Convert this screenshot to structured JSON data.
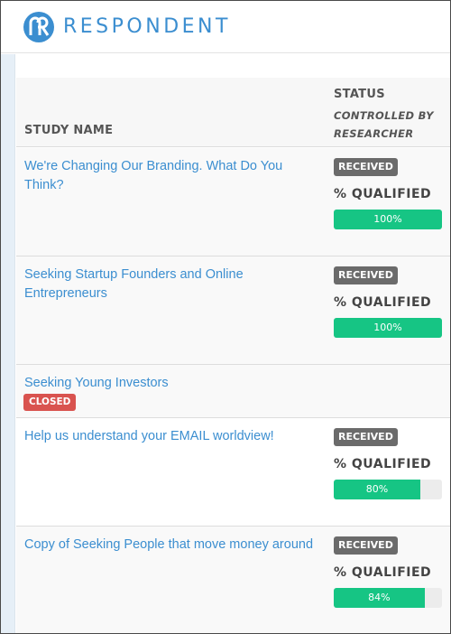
{
  "brand": {
    "name": "RESPONDENT",
    "accent": "#3b8ed0"
  },
  "table": {
    "col_name": "STUDY NAME",
    "col_status": "STATUS",
    "col_status_sub": "CONTROLLED BY RESEARCHER"
  },
  "qualified_label": "% QUALIFIED",
  "colors": {
    "progress": "#16c584",
    "received": "#6b6b6b",
    "closed": "#d9534f"
  },
  "rows": [
    {
      "name": "We're Changing Our Branding. What Do You Think?",
      "status": "RECEIVED",
      "qualified": "100%",
      "qualified_fraction": 1.0
    },
    {
      "name": "Seeking Startup Founders and Online Entrepreneurs",
      "status": "RECEIVED",
      "qualified": "100%",
      "qualified_fraction": 1.0
    },
    {
      "name": "Seeking Young Investors",
      "status": "CLOSED"
    },
    {
      "name": "Help us understand your EMAIL worldview!",
      "status": "RECEIVED",
      "qualified": "80%",
      "qualified_fraction": 0.8
    },
    {
      "name": "Copy of Seeking People that move money around",
      "status": "RECEIVED",
      "qualified": "84%",
      "qualified_fraction": 0.84
    }
  ]
}
